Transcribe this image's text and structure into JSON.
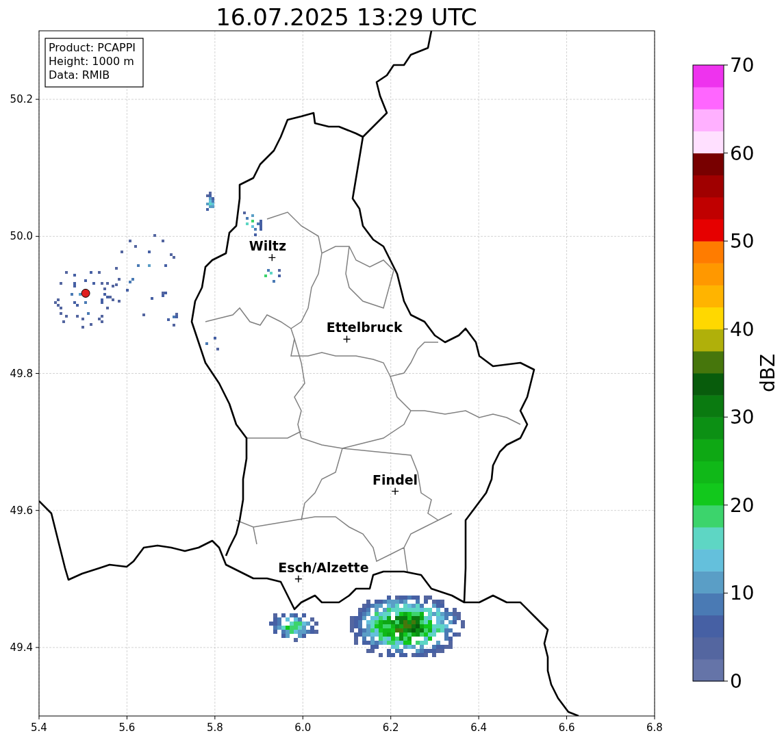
{
  "title": "16.07.2025 13:29 UTC",
  "info_box": [
    "Product: PCAPPI",
    "Height: 1000 m",
    "Data: RMIB"
  ],
  "map": {
    "y_ticks": [
      "50.2",
      "50.0",
      "49.8",
      "49.6",
      "49.4"
    ],
    "x_ticks": [
      "5.4",
      "5.6",
      "5.8",
      "6.0",
      "6.2",
      "6.4",
      "6.6",
      "6.8"
    ],
    "cities": [
      {
        "label": "Wiltz"
      },
      {
        "label": "Ettelbruck"
      },
      {
        "label": "Findel"
      },
      {
        "label": "Esch/Alzette"
      }
    ]
  },
  "colorbar": {
    "label": "dBZ",
    "ticks": [
      "70",
      "60",
      "50",
      "40",
      "30",
      "20",
      "10",
      "0"
    ]
  }
}
